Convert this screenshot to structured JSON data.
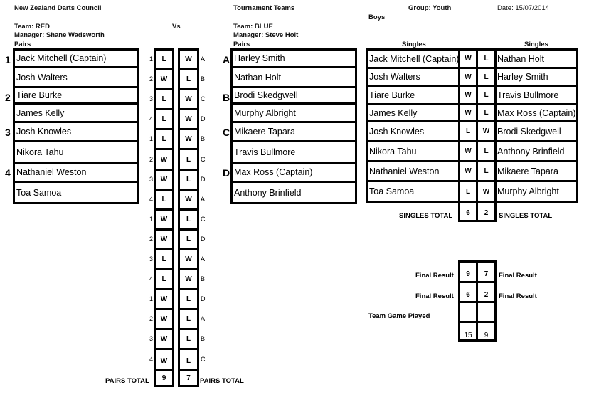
{
  "header": {
    "org": "New Zealand Darts Council",
    "event": "Tournament Teams",
    "group": "Group:  Youth",
    "date": "Date: 15/07/2014",
    "division": "Boys",
    "vs": "Vs"
  },
  "home": {
    "team": "Team:  RED",
    "manager": "Manager:  Shane Wadsworth",
    "pairs_heading": "Pairs",
    "pairs": [
      {
        "label": "1",
        "players": [
          "Jack Mitchell  (Captain)",
          "Josh Walters"
        ]
      },
      {
        "label": "2",
        "players": [
          "Tiare Burke",
          "James Kelly"
        ]
      },
      {
        "label": "3",
        "players": [
          "Josh Knowles",
          "Nikora Tahu"
        ]
      },
      {
        "label": "4",
        "players": [
          "Nathaniel Weston",
          "Toa Samoa"
        ]
      }
    ]
  },
  "away": {
    "team": "Team:   BLUE",
    "manager": "Manager: Steve Holt",
    "pairs_heading": "Pairs",
    "pairs": [
      {
        "label": "A",
        "players": [
          "Harley Smith",
          "Nathan Holt"
        ]
      },
      {
        "label": "B",
        "players": [
          "Brodi Skedgwell",
          "Murphy Albright"
        ]
      },
      {
        "label": "C",
        "players": [
          "Mikaere Tapara",
          "Travis Bullmore"
        ]
      },
      {
        "label": "D",
        "players": [
          "Max Ross  (Captain)",
          "Anthony Brinfield"
        ]
      }
    ]
  },
  "pairs_games": [
    {
      "home_pair": "1",
      "home": "L",
      "away": "W",
      "away_pair": "A"
    },
    {
      "home_pair": "2",
      "home": "W",
      "away": "L",
      "away_pair": "B"
    },
    {
      "home_pair": "3",
      "home": "L",
      "away": "W",
      "away_pair": "C"
    },
    {
      "home_pair": "4",
      "home": "L",
      "away": "W",
      "away_pair": "D"
    },
    {
      "home_pair": "1",
      "home": "L",
      "away": "W",
      "away_pair": "B"
    },
    {
      "home_pair": "2",
      "home": "W",
      "away": "L",
      "away_pair": "C"
    },
    {
      "home_pair": "3",
      "home": "W",
      "away": "L",
      "away_pair": "D"
    },
    {
      "home_pair": "4",
      "home": "L",
      "away": "W",
      "away_pair": "A"
    },
    {
      "home_pair": "1",
      "home": "W",
      "away": "L",
      "away_pair": "C"
    },
    {
      "home_pair": "2",
      "home": "W",
      "away": "L",
      "away_pair": "D"
    },
    {
      "home_pair": "3",
      "home": "L",
      "away": "W",
      "away_pair": "A"
    },
    {
      "home_pair": "4",
      "home": "L",
      "away": "W",
      "away_pair": "B"
    },
    {
      "home_pair": "1",
      "home": "W",
      "away": "L",
      "away_pair": "D"
    },
    {
      "home_pair": "2",
      "home": "W",
      "away": "L",
      "away_pair": "A"
    },
    {
      "home_pair": "3",
      "home": "W",
      "away": "L",
      "away_pair": "B"
    },
    {
      "home_pair": "4",
      "home": "W",
      "away": "L",
      "away_pair": "C"
    }
  ],
  "pairs_total": {
    "label": "PAIRS TOTAL",
    "home": "9",
    "away": "7"
  },
  "singles": {
    "heading_home": "Singles",
    "heading_away": "Singles",
    "games": [
      {
        "home": "Jack Mitchell (Captain)",
        "home_result": "W",
        "away_result": "L",
        "away": "Nathan Holt"
      },
      {
        "home": "Josh Walters",
        "home_result": "W",
        "away_result": "L",
        "away": "Harley Smith"
      },
      {
        "home": "Tiare Burke",
        "home_result": "W",
        "away_result": "L",
        "away": "Travis Bullmore"
      },
      {
        "home": "James Kelly",
        "home_result": "W",
        "away_result": "L",
        "away": "Max Ross  (Captain)"
      },
      {
        "home": "Josh Knowles",
        "home_result": "L",
        "away_result": "W",
        "away": "Brodi Skedgwell"
      },
      {
        "home": "Nikora Tahu",
        "home_result": "W",
        "away_result": "L",
        "away": "Anthony Brinfield"
      },
      {
        "home": "Nathaniel Weston",
        "home_result": "W",
        "away_result": "L",
        "away": "Mikaere Tapara"
      },
      {
        "home": "Toa Samoa",
        "home_result": "L",
        "away_result": "W",
        "away": "Murphy Albright"
      }
    ],
    "total": {
      "label": "SINGLES TOTAL",
      "home": "6",
      "away": "2"
    }
  },
  "final": {
    "label": "Final Result",
    "row1": {
      "home": "9",
      "away": "7"
    },
    "row2": {
      "home": "6",
      "away": "2"
    },
    "team_game_label": "Team Game Played",
    "team_game": {
      "home": "",
      "away": ""
    },
    "grand_total": {
      "home": "15",
      "away": "9"
    }
  }
}
